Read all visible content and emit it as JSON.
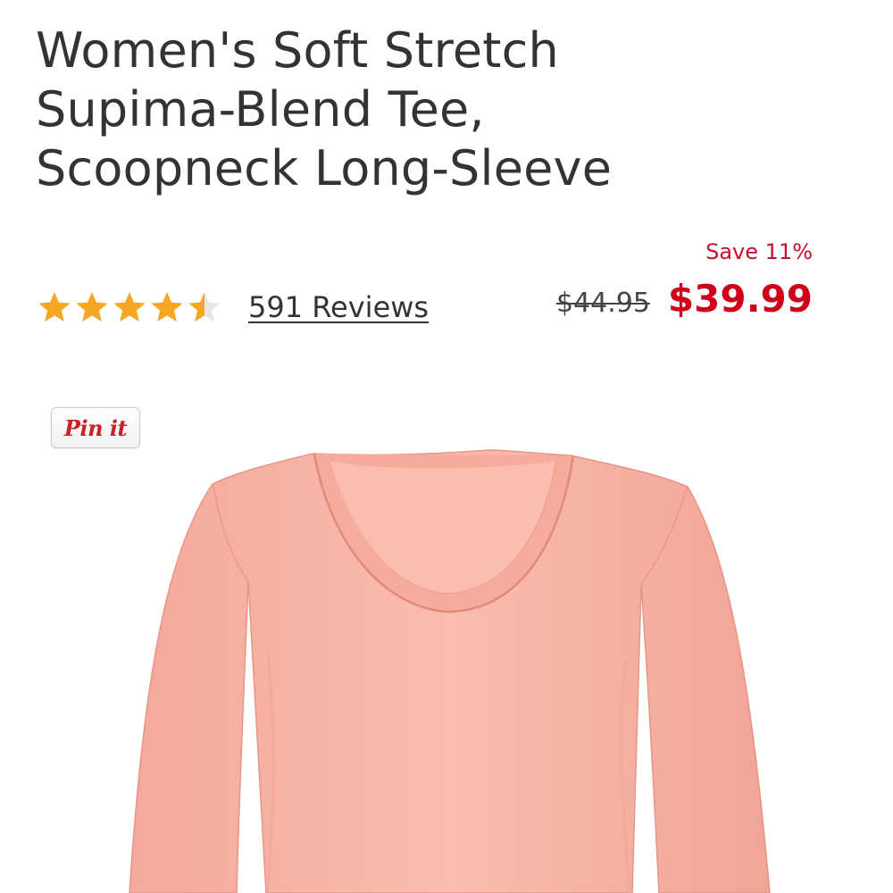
{
  "product": {
    "title_lines": [
      "Women's Soft Stretch",
      "Supima-Blend Tee,",
      "Scoopneck Long-Sleeve"
    ],
    "rating": {
      "value": 4.5,
      "max": 5,
      "star_color": "#f5a623",
      "empty_star_color": "#e6e6e6"
    },
    "reviews_label": "591 Reviews",
    "pricing": {
      "save_label": "Save 11%",
      "original_price": "$44.95",
      "sale_price": "$39.99",
      "sale_color": "#d0021b"
    },
    "image": {
      "icon": "pink-long-sleeve-tee-image",
      "color": "#f7b3a6"
    }
  },
  "pinterest": {
    "label": "Pin it",
    "icon": "pinterest-pin-it-icon"
  }
}
